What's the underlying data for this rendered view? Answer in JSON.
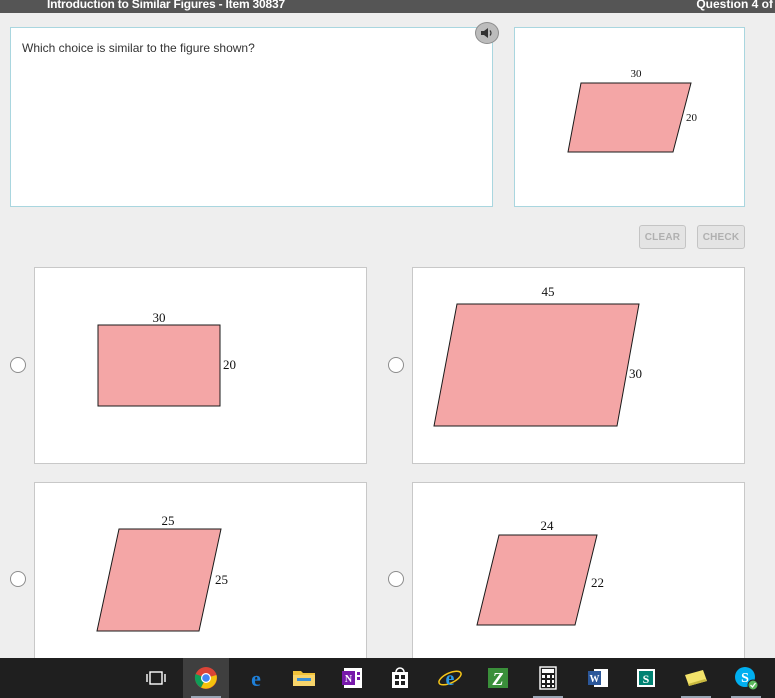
{
  "header": {
    "title": "Introduction to Similar Figures - Item 30837",
    "counter": "Question 4 of"
  },
  "question": {
    "text": "Which choice is similar to the figure shown?",
    "figure": {
      "top_label": "30",
      "side_label": "20"
    }
  },
  "buttons": {
    "clear": "CLEAR",
    "check": "CHECK"
  },
  "choices": [
    {
      "top_label": "30",
      "side_label": "20"
    },
    {
      "top_label": "45",
      "side_label": "30"
    },
    {
      "top_label": "25",
      "side_label": "25"
    },
    {
      "top_label": "24",
      "side_label": "22"
    }
  ],
  "colors": {
    "shape_fill": "#f4a6a6",
    "panel_border": "#a9d6df",
    "header_bg": "#555555"
  },
  "taskbar": {
    "items": [
      "task-view-icon",
      "chrome-icon",
      "edge-icon",
      "file-explorer-icon",
      "onenote-icon",
      "store-icon",
      "internet-explorer-icon",
      "zotero-icon",
      "calculator-icon",
      "word-icon",
      "sway-icon",
      "sticky-notes-icon",
      "skype-icon"
    ]
  }
}
